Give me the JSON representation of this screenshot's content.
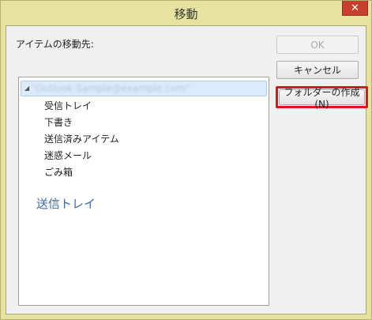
{
  "window": {
    "title": "移動",
    "close_icon": "✕"
  },
  "dialog": {
    "destination_label": "アイテムの移動先:",
    "buttons": {
      "ok": "OK",
      "cancel": "キャンセル",
      "new_folder": "フォルダーの作成(N)"
    }
  },
  "tree": {
    "expander": "◢",
    "root_label": "\"Outlook-Sample@example.com\"",
    "items": [
      "受信トレイ",
      "下書き",
      "送信済みアイテム",
      "迷惑メール",
      "ごみ箱"
    ],
    "drag_label": "送信トレイ"
  }
}
